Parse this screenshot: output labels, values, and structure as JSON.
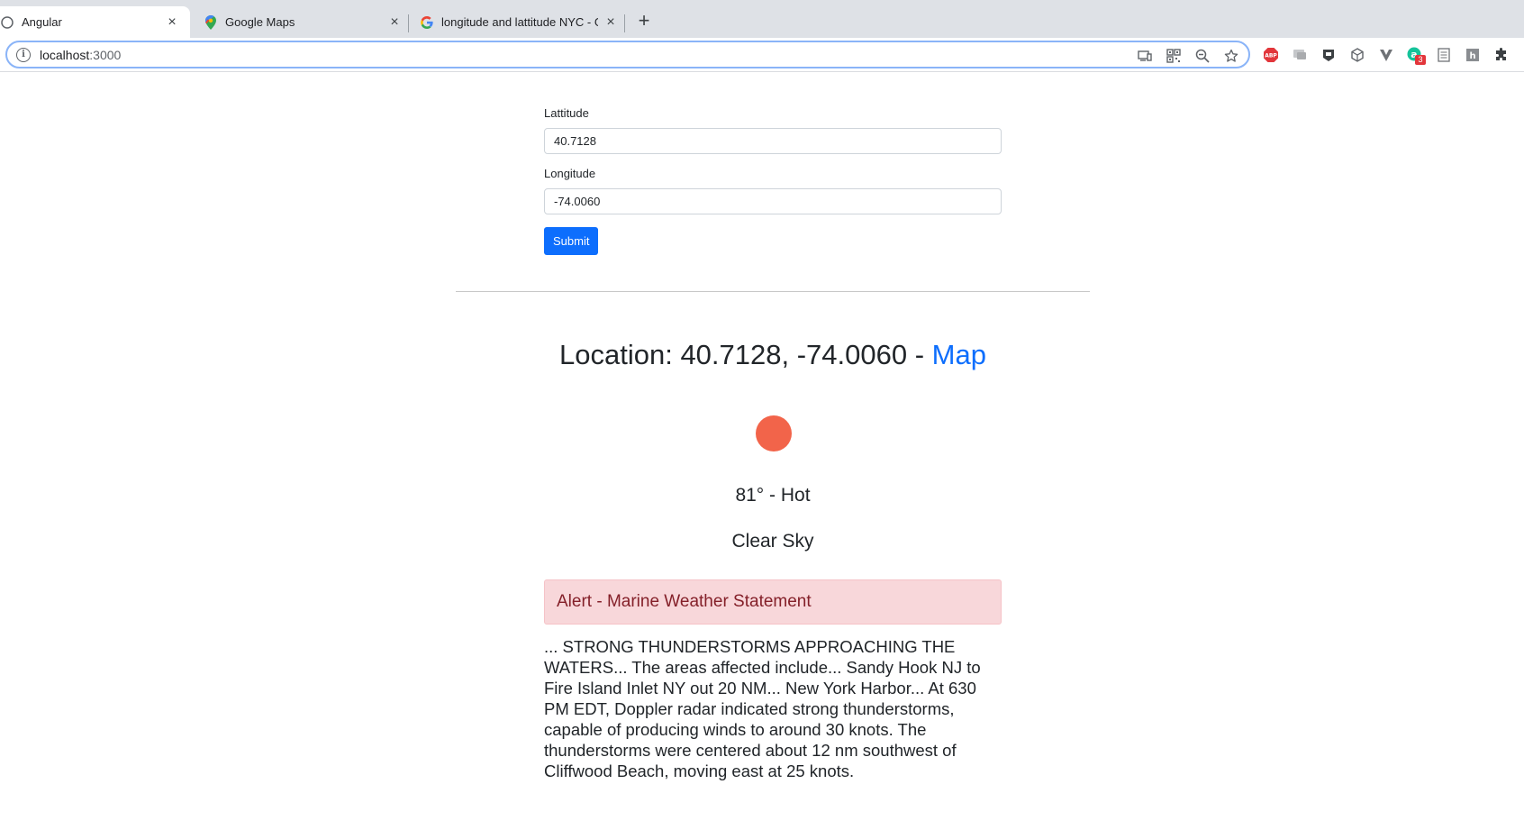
{
  "browser": {
    "tabs": [
      {
        "title": "Angular",
        "icon": "angular-favicon-icon",
        "active": true
      },
      {
        "title": "Google Maps",
        "icon": "google-maps-favicon-icon",
        "active": false
      },
      {
        "title": "longitude and lattitude NYC - G",
        "icon": "google-favicon-icon",
        "active": false
      }
    ],
    "new_tab_label": "+",
    "close_glyph": "×",
    "url_host": "localhost",
    "url_port": ":3000",
    "info_glyph": "i",
    "extensions": [
      "abp-icon",
      "screen-icon",
      "puzzle-shield-icon",
      "cube-icon",
      "v-icon",
      "grammarly-icon",
      "doc-icon",
      "hn-icon",
      "extensions-icon"
    ],
    "badge_count": "3"
  },
  "form": {
    "lat_label": "Lattitude",
    "lat_value": "40.7128",
    "lng_label": "Longitude",
    "lng_value": "-74.0060",
    "submit_label": "Submit"
  },
  "weather": {
    "location_prefix": "Location: 40.7128, -74.0060 - ",
    "map_link": "Map",
    "status_color": "#f2644a",
    "temperature": "81° - Hot",
    "sky": "Clear Sky",
    "alert_title": "Alert - Marine Weather Statement",
    "alert_body": "... STRONG THUNDERSTORMS APPROACHING THE WATERS... The areas affected include... Sandy Hook NJ to Fire Island Inlet NY out 20 NM... New York Harbor... At 630 PM EDT, Doppler radar indicated strong thunderstorms, capable of producing winds to around 30 knots. The thunderstorms were centered about 12 nm southwest of Cliffwood Beach, moving east at 25 knots."
  },
  "colors": {
    "primary": "#0d6efd",
    "alert_bg": "#f8d7da",
    "alert_text": "#842029"
  }
}
